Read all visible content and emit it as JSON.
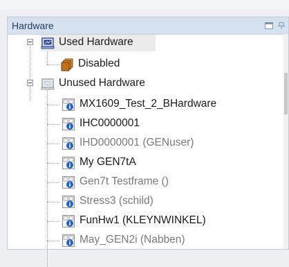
{
  "panel": {
    "title": "Hardware"
  },
  "tree": {
    "used": {
      "label": "Used Hardware",
      "children": [
        {
          "label": "Disabled"
        }
      ]
    },
    "unused": {
      "label": "Unused Hardware",
      "items": [
        {
          "label": "MX1609_Test_2_BHardware",
          "muted": false
        },
        {
          "label": "IHC0000001",
          "muted": false
        },
        {
          "label": "IHD0000001 (GENuser)",
          "muted": true
        },
        {
          "label": "My GEN7tA",
          "muted": false
        },
        {
          "label": "Gen7t Testframe ()",
          "muted": true
        },
        {
          "label": "Stress3 (schild)",
          "muted": true
        },
        {
          "label": "FunHw1 (KLEYNWINKEL)",
          "muted": false
        },
        {
          "label": "May_GEN2i (Nabben)",
          "muted": true
        }
      ]
    }
  },
  "colors": {
    "title_bg": "#d6e2f0",
    "title_text": "#1f3a5f",
    "muted_text": "#7a7a7a"
  },
  "icons": {
    "pin": "pin-icon",
    "used": "hardware-folder-icon",
    "disabled": "disabled-folder-icon",
    "unused": "hardware-folder-gray-icon",
    "item": "hardware-info-icon"
  }
}
